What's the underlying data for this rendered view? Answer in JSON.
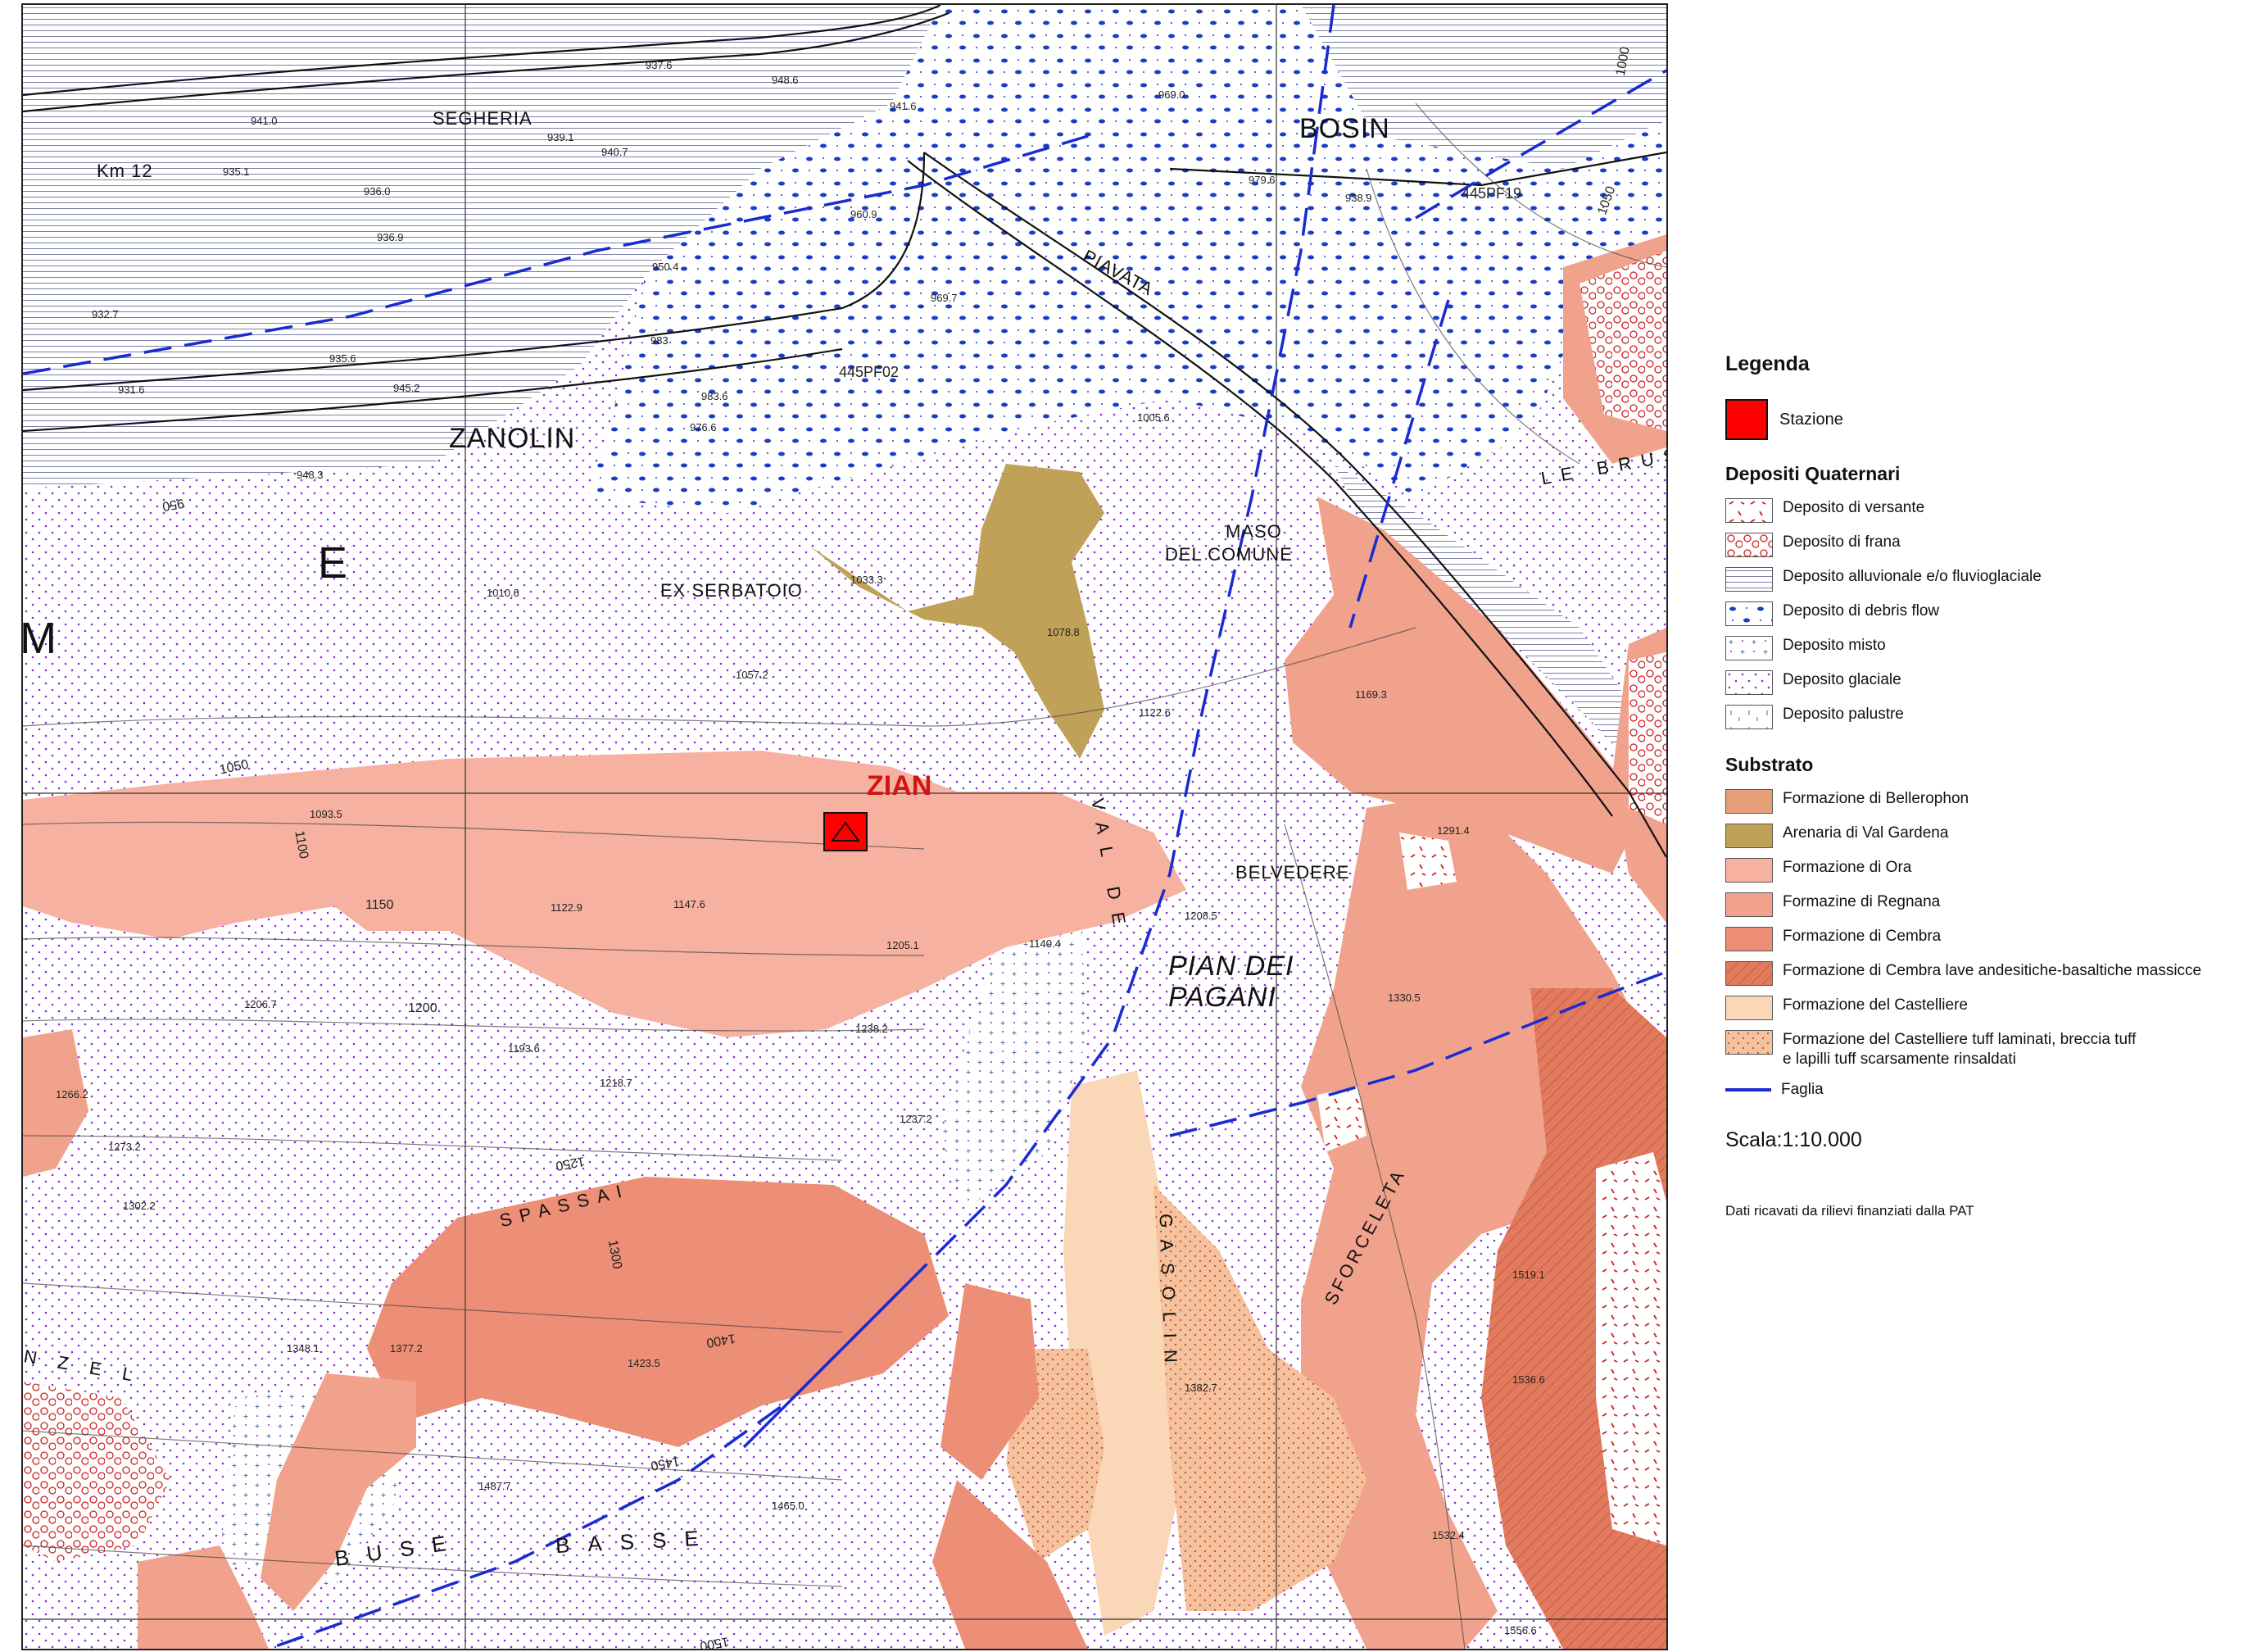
{
  "map": {
    "station_label": "ZIAN",
    "places": [
      {
        "id": "bosin",
        "text": "BOSIN"
      },
      {
        "id": "segheria",
        "text": "SEGHERIA"
      },
      {
        "id": "zanolin",
        "text": "ZANOLIN"
      },
      {
        "id": "km12",
        "text": "Km 12"
      },
      {
        "id": "piavata",
        "text": "PIAVATA"
      },
      {
        "id": "maso",
        "text": "MASO"
      },
      {
        "id": "del-comune",
        "text": "DEL COMUNE"
      },
      {
        "id": "ex-serbatoio",
        "text": "EX SERBATOIO"
      },
      {
        "id": "belvedere",
        "text": "BELVEDERE"
      },
      {
        "id": "pian-dei",
        "text": "PIAN DEI"
      },
      {
        "id": "pagani",
        "text": "PAGANI"
      },
      {
        "id": "spassai",
        "text": "SPASSAI"
      },
      {
        "id": "sforceleta",
        "text": "SFORCELETA"
      },
      {
        "id": "buse",
        "text": "BUSE"
      },
      {
        "id": "basse",
        "text": "BASSE"
      },
      {
        "id": "le-brus",
        "text": "LE BRUS"
      },
      {
        "id": "gasolin",
        "text": "GASOLIN"
      },
      {
        "id": "val-de",
        "text": "VAL DE"
      },
      {
        "id": "e-letter",
        "text": "E"
      },
      {
        "id": "m-letter",
        "text": "M"
      },
      {
        "id": "nzel",
        "text": "NZEL"
      }
    ],
    "elevations": [
      {
        "id": "e1",
        "text": "937.6"
      },
      {
        "id": "e2",
        "text": "941.0"
      },
      {
        "id": "e3",
        "text": "939.1"
      },
      {
        "id": "e4",
        "text": "940.7"
      },
      {
        "id": "e5",
        "text": "935.1"
      },
      {
        "id": "e6",
        "text": "936.0"
      },
      {
        "id": "e7",
        "text": "936.9"
      },
      {
        "id": "e8",
        "text": "932.7"
      },
      {
        "id": "e9",
        "text": "935.6"
      },
      {
        "id": "e10",
        "text": "931.6"
      },
      {
        "id": "e11",
        "text": "945.2"
      },
      {
        "id": "e12",
        "text": "948.3"
      },
      {
        "id": "e13",
        "text": "948.6"
      },
      {
        "id": "e14",
        "text": "941.6"
      },
      {
        "id": "e15",
        "text": "960.9"
      },
      {
        "id": "e16",
        "text": "950.4"
      },
      {
        "id": "e17",
        "text": "969.7"
      },
      {
        "id": "e18",
        "text": "983"
      },
      {
        "id": "e19",
        "text": "983.6"
      },
      {
        "id": "e20",
        "text": "976.6"
      },
      {
        "id": "e21",
        "text": "445PF02"
      },
      {
        "id": "e22",
        "text": "1005.6"
      },
      {
        "id": "e23",
        "text": "969.0"
      },
      {
        "id": "e24",
        "text": "979.6"
      },
      {
        "id": "e25",
        "text": "938.9"
      },
      {
        "id": "e26",
        "text": "445PF19"
      },
      {
        "id": "e27",
        "text": "1033.3"
      },
      {
        "id": "e28",
        "text": "1010.6"
      },
      {
        "id": "e29",
        "text": "1078.8"
      },
      {
        "id": "e30",
        "text": "1057.2"
      },
      {
        "id": "e31",
        "text": "1122.6"
      },
      {
        "id": "e32",
        "text": "1169.3"
      },
      {
        "id": "e33",
        "text": "1093.5"
      },
      {
        "id": "e34",
        "text": "1122.9"
      },
      {
        "id": "e35",
        "text": "1147.6"
      },
      {
        "id": "e36",
        "text": "1205.1"
      },
      {
        "id": "e37",
        "text": "1208.5"
      },
      {
        "id": "e38",
        "text": "1291.4"
      },
      {
        "id": "e39",
        "text": "1206.7"
      },
      {
        "id": "e40",
        "text": "1193.6"
      },
      {
        "id": "e41",
        "text": "1218.7"
      },
      {
        "id": "e42",
        "text": "1238.2"
      },
      {
        "id": "e43",
        "text": "1237.2"
      },
      {
        "id": "e44",
        "text": "1330.5"
      },
      {
        "id": "e45",
        "text": "1266.2"
      },
      {
        "id": "e46",
        "text": "1273.2"
      },
      {
        "id": "e47",
        "text": "1302.2"
      },
      {
        "id": "e48",
        "text": "1348.1"
      },
      {
        "id": "e49",
        "text": "1377.2"
      },
      {
        "id": "e50",
        "text": "1423.5"
      },
      {
        "id": "e51",
        "text": "1382.7"
      },
      {
        "id": "e52",
        "text": "1519.1"
      },
      {
        "id": "e53",
        "text": "1536.6"
      },
      {
        "id": "e54",
        "text": "1487.7"
      },
      {
        "id": "e55",
        "text": "1465.0"
      },
      {
        "id": "e56",
        "text": "1532.4"
      },
      {
        "id": "e57",
        "text": "1556.6"
      },
      {
        "id": "e58",
        "text": "1140.4"
      }
    ],
    "contour_labels": [
      {
        "id": "c1000",
        "text": "1000"
      },
      {
        "id": "c1050a",
        "text": "1050"
      },
      {
        "id": "c1050b",
        "text": "1050"
      },
      {
        "id": "c950",
        "text": "950"
      },
      {
        "id": "c1100",
        "text": "1100"
      },
      {
        "id": "c1150",
        "text": "1150"
      },
      {
        "id": "c1200",
        "text": "1200"
      },
      {
        "id": "c1250",
        "text": "1250"
      },
      {
        "id": "c1300",
        "text": "1300"
      },
      {
        "id": "c1400",
        "text": "1400"
      },
      {
        "id": "c1450",
        "text": "1450"
      },
      {
        "id": "c1500",
        "text": "1500"
      }
    ],
    "colors": {
      "bellerophon": "#e5a07a",
      "val_gardena": "#bfa257",
      "ora": "#f6b1a0",
      "regnana": "#f1a28d",
      "cembra": "#ec8f76",
      "cembra_lave": "#e27a5e",
      "castelliere": "#f9d7b7",
      "castelliere_tuff": "#f4c29e",
      "fault": "#1a2bd1",
      "station": "#ff0000",
      "station_label": "#d11414",
      "glacial_dot": "#8a2bd6",
      "debris_blue": "#1b3cc7",
      "landslide_red": "#cc1f1f"
    }
  },
  "legend": {
    "title": "Legenda",
    "station": "Stazione",
    "quaternary_title": "Depositi Quaternari",
    "quaternary_items": [
      {
        "id": "versante",
        "label": "Deposito di versante"
      },
      {
        "id": "frana",
        "label": "Deposito di frana"
      },
      {
        "id": "alluvionale",
        "label": "Deposito alluvionale e/o fluvioglaciale"
      },
      {
        "id": "debris",
        "label": "Deposito di debris flow"
      },
      {
        "id": "misto",
        "label": "Deposito misto"
      },
      {
        "id": "glaciale",
        "label": "Deposito glaciale"
      },
      {
        "id": "palustre",
        "label": "Deposito palustre"
      }
    ],
    "substrate_title": "Substrato",
    "substrate_items": [
      {
        "id": "bellerophon",
        "label": "Formazione di Bellerophon"
      },
      {
        "id": "valgardena",
        "label": "Arenaria di Val Gardena"
      },
      {
        "id": "ora",
        "label": "Formazione di Ora"
      },
      {
        "id": "regnana",
        "label": "Formazine di Regnana"
      },
      {
        "id": "cembra",
        "label": "Formazione di Cembra"
      },
      {
        "id": "cembralave",
        "label": "Formazione di Cembra lave andesitiche-basaltiche massicce"
      },
      {
        "id": "castelliere",
        "label": "Formazione del Castelliere"
      },
      {
        "id": "castellieretuff",
        "label": "Formazione del Castelliere tuff laminati, breccia tuff",
        "label2": "e lapilli tuff scarsamente rinsaldati"
      }
    ],
    "fault": "Faglia",
    "scale": "Scala:1:10.000",
    "credit": "Dati ricavati da rilievi finanziati dalla PAT"
  }
}
